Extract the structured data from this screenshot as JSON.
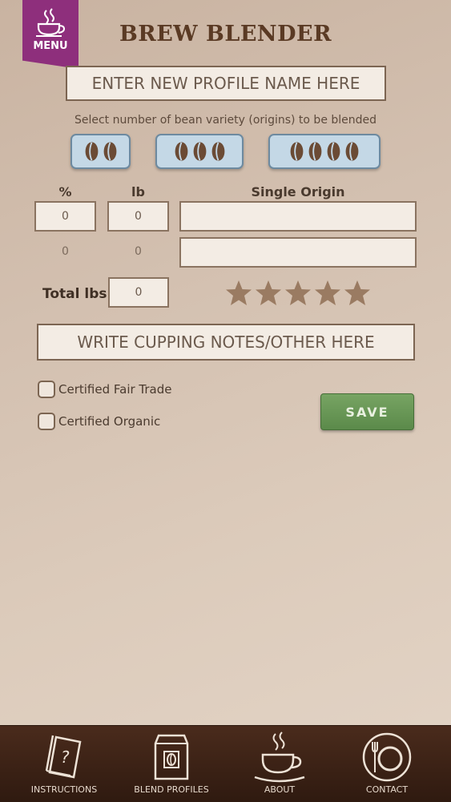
{
  "menu": {
    "label": "MENU"
  },
  "app": {
    "title": "BREW BLENDER"
  },
  "profile": {
    "placeholder": "ENTER NEW PROFILE NAME HERE"
  },
  "origins": {
    "hint": "Select number of bean variety (origins) to be blended",
    "options": [
      {
        "count": 2
      },
      {
        "count": 3
      },
      {
        "count": 4
      }
    ]
  },
  "table": {
    "headers": {
      "percent": "%",
      "lb": "lb",
      "single_origin": "Single Origin"
    },
    "rows": [
      {
        "percent": "0",
        "lb": "0",
        "origin": ""
      },
      {
        "percent": "0",
        "lb": "0",
        "origin": ""
      }
    ]
  },
  "total": {
    "label": "Total lbs",
    "value": "0"
  },
  "rating": {
    "max": 5,
    "value": 0
  },
  "notes": {
    "placeholder": "WRITE CUPPING NOTES/OTHER HERE"
  },
  "checks": [
    {
      "label": "Certified Fair Trade",
      "checked": false
    },
    {
      "label": "Certified Organic",
      "checked": false
    }
  ],
  "save": {
    "label": "SAVE"
  },
  "nav": [
    {
      "label": "INSTRUCTIONS",
      "icon": "instructions-icon"
    },
    {
      "label": "BLEND PROFILES",
      "icon": "coffee-bag-icon"
    },
    {
      "label": "ABOUT",
      "icon": "coffee-cup-icon"
    },
    {
      "label": "CONTACT",
      "icon": "contact-plate-icon"
    }
  ],
  "colors": {
    "accent_purple": "#8e2f7c",
    "save_green": "#5b8a4a",
    "origin_button": "#c4d8e6",
    "nav_bar": "#3a2214",
    "star": "#9a7b62"
  }
}
